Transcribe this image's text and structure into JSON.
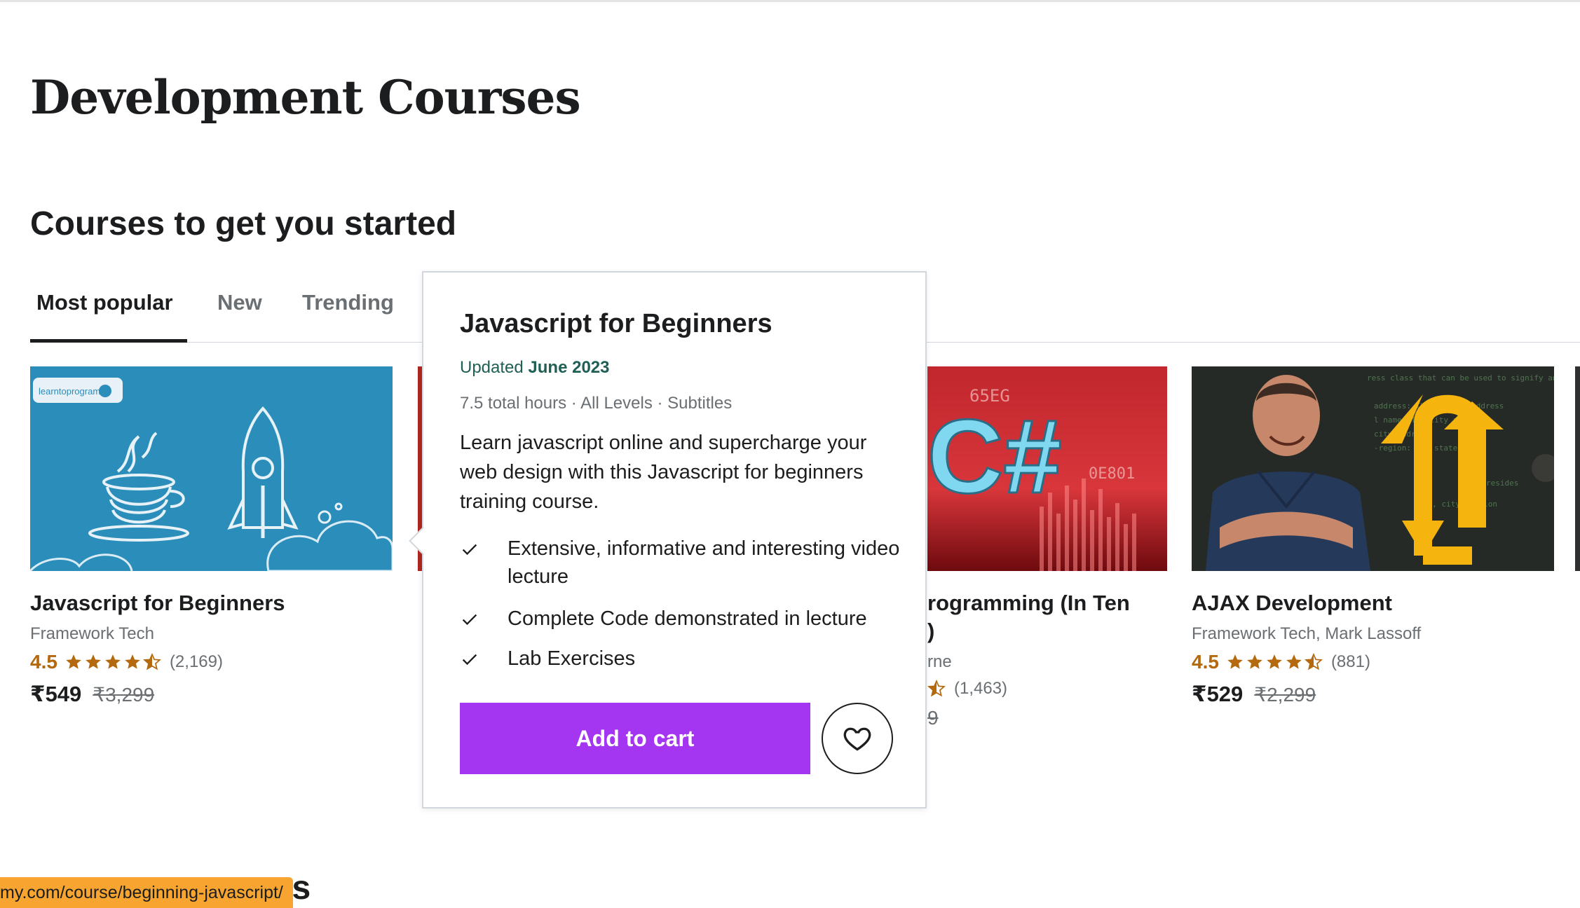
{
  "page": {
    "title": "Development Courses",
    "section_title": "Courses to get you started",
    "next_section_title": "s"
  },
  "tabs": [
    {
      "label": "Most popular",
      "active": true
    },
    {
      "label": "New",
      "active": false
    },
    {
      "label": "Trending",
      "active": false
    }
  ],
  "cards": [
    {
      "title": "Javascript for Beginners",
      "author": "Framework Tech",
      "rating": "4.5",
      "rating_stars": 4.5,
      "reviews": "(2,169)",
      "price": "₹549",
      "old_price": "₹3,299",
      "thumb_label": "learntoprogram"
    },
    {
      "title_fragment": "rogramming (In Ten",
      "title_fragment_2": ")",
      "author_fragment": "rne",
      "reviews": "(1,463)",
      "old_price_fragment": "9"
    },
    {
      "title": "AJAX Development",
      "author": "Framework Tech, Mark Lassoff",
      "rating": "4.5",
      "rating_stars": 4.5,
      "reviews": "(881)",
      "price": "₹529",
      "old_price": "₹2,299"
    }
  ],
  "popup": {
    "title": "Javascript for Beginners",
    "updated_prefix": "Updated ",
    "updated_date": "June 2023",
    "meta": "7.5 total hours · All Levels · Subtitles",
    "description": "Learn javascript online and supercharge your web design with this Javascript for beginners training course.",
    "features": [
      "Extensive, informative and interesting video lecture",
      "Complete Code demonstrated in lecture",
      "Lab Exercises"
    ],
    "add_to_cart": "Add to cart",
    "wishlist_icon": "heart-icon"
  },
  "status_bar": {
    "url": "my.com/course/beginning-javascript/"
  },
  "colors": {
    "accent_purple": "#a435f0",
    "rating_orange": "#b4690e",
    "updated_green": "#1e6055",
    "status_bar_bg": "#f7a530"
  }
}
